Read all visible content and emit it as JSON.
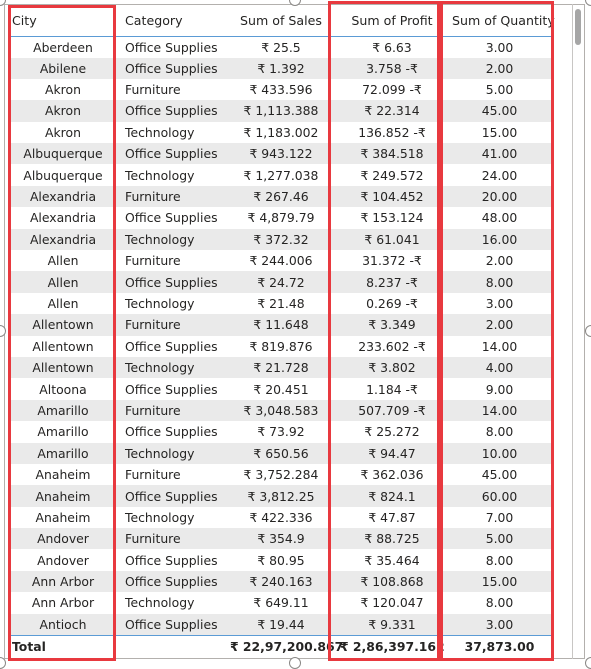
{
  "table": {
    "columns": [
      {
        "key": "city",
        "label": "City"
      },
      {
        "key": "category",
        "label": "Category"
      },
      {
        "key": "sales",
        "label": "Sum of Sales"
      },
      {
        "key": "profit",
        "label": "Sum of Profit"
      },
      {
        "key": "quantity",
        "label": "Sum of Quantity"
      }
    ],
    "rows": [
      {
        "city": "Aberdeen",
        "category": "Office Supplies",
        "sales": "₹ 25.5",
        "profit": "₹ 6.63",
        "quantity": "3.00"
      },
      {
        "city": "Abilene",
        "category": "Office Supplies",
        "sales": "₹ 1.392",
        "profit": "3.758 -₹",
        "quantity": "2.00"
      },
      {
        "city": "Akron",
        "category": "Furniture",
        "sales": "₹ 433.596",
        "profit": "72.099 -₹",
        "quantity": "5.00"
      },
      {
        "city": "Akron",
        "category": "Office Supplies",
        "sales": "₹ 1,113.388",
        "profit": "₹ 22.314",
        "quantity": "45.00"
      },
      {
        "city": "Akron",
        "category": "Technology",
        "sales": "₹ 1,183.002",
        "profit": "136.852 -₹",
        "quantity": "15.00"
      },
      {
        "city": "Albuquerque",
        "category": "Office Supplies",
        "sales": "₹ 943.122",
        "profit": "₹ 384.518",
        "quantity": "41.00"
      },
      {
        "city": "Albuquerque",
        "category": "Technology",
        "sales": "₹ 1,277.038",
        "profit": "₹ 249.572",
        "quantity": "24.00"
      },
      {
        "city": "Alexandria",
        "category": "Furniture",
        "sales": "₹ 267.46",
        "profit": "₹ 104.452",
        "quantity": "20.00"
      },
      {
        "city": "Alexandria",
        "category": "Office Supplies",
        "sales": "₹ 4,879.79",
        "profit": "₹ 153.124",
        "quantity": "48.00"
      },
      {
        "city": "Alexandria",
        "category": "Technology",
        "sales": "₹ 372.32",
        "profit": "₹ 61.041",
        "quantity": "16.00"
      },
      {
        "city": "Allen",
        "category": "Furniture",
        "sales": "₹ 244.006",
        "profit": "31.372 -₹",
        "quantity": "2.00"
      },
      {
        "city": "Allen",
        "category": "Office Supplies",
        "sales": "₹ 24.72",
        "profit": "8.237 -₹",
        "quantity": "8.00"
      },
      {
        "city": "Allen",
        "category": "Technology",
        "sales": "₹ 21.48",
        "profit": "0.269 -₹",
        "quantity": "3.00"
      },
      {
        "city": "Allentown",
        "category": "Furniture",
        "sales": "₹ 11.648",
        "profit": "₹ 3.349",
        "quantity": "2.00"
      },
      {
        "city": "Allentown",
        "category": "Office Supplies",
        "sales": "₹ 819.876",
        "profit": "233.602 -₹",
        "quantity": "14.00"
      },
      {
        "city": "Allentown",
        "category": "Technology",
        "sales": "₹ 21.728",
        "profit": "₹ 3.802",
        "quantity": "4.00"
      },
      {
        "city": "Altoona",
        "category": "Office Supplies",
        "sales": "₹ 20.451",
        "profit": "1.184 -₹",
        "quantity": "9.00"
      },
      {
        "city": "Amarillo",
        "category": "Furniture",
        "sales": "₹ 3,048.583",
        "profit": "507.709 -₹",
        "quantity": "14.00"
      },
      {
        "city": "Amarillo",
        "category": "Office Supplies",
        "sales": "₹ 73.92",
        "profit": "₹ 25.272",
        "quantity": "8.00"
      },
      {
        "city": "Amarillo",
        "category": "Technology",
        "sales": "₹ 650.56",
        "profit": "₹ 94.47",
        "quantity": "10.00"
      },
      {
        "city": "Anaheim",
        "category": "Furniture",
        "sales": "₹ 3,752.284",
        "profit": "₹ 362.036",
        "quantity": "45.00"
      },
      {
        "city": "Anaheim",
        "category": "Office Supplies",
        "sales": "₹ 3,812.25",
        "profit": "₹ 824.1",
        "quantity": "60.00"
      },
      {
        "city": "Anaheim",
        "category": "Technology",
        "sales": "₹ 422.336",
        "profit": "₹ 47.87",
        "quantity": "7.00"
      },
      {
        "city": "Andover",
        "category": "Furniture",
        "sales": "₹ 354.9",
        "profit": "₹ 88.725",
        "quantity": "5.00"
      },
      {
        "city": "Andover",
        "category": "Office Supplies",
        "sales": "₹ 80.95",
        "profit": "₹ 35.464",
        "quantity": "8.00"
      },
      {
        "city": "Ann Arbor",
        "category": "Office Supplies",
        "sales": "₹ 240.163",
        "profit": "₹ 108.868",
        "quantity": "15.00"
      },
      {
        "city": "Ann Arbor",
        "category": "Technology",
        "sales": "₹ 649.11",
        "profit": "₹ 120.047",
        "quantity": "8.00"
      },
      {
        "city": "Antioch",
        "category": "Office Supplies",
        "sales": "₹ 19.44",
        "profit": "₹ 9.331",
        "quantity": "3.00"
      }
    ],
    "total": {
      "label": "Total",
      "sales": "₹ 22,97,200.867",
      "profit": "₹ 2,86,397.162",
      "quantity": "37,873.00"
    }
  },
  "highlights": {
    "color": "#e8393f",
    "columns": [
      "City",
      "Sum of Profit",
      "Sum of Quantity"
    ]
  },
  "colors": {
    "header_rule": "#5b9bd5",
    "stripe": "#eaeaea",
    "text": "#252423"
  }
}
